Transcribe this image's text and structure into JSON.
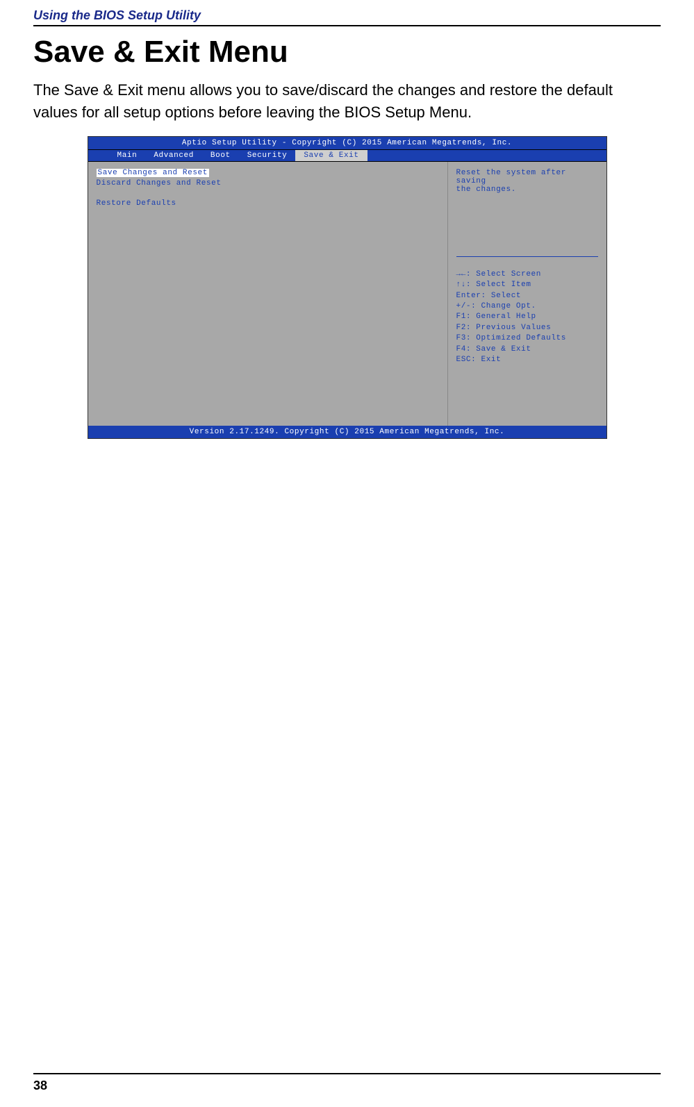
{
  "chapter": "Using the BIOS Setup Utility",
  "heading": "Save & Exit Menu",
  "body": "The Save & Exit menu allows you to save/discard the changes and restore the default values for all setup options before leaving the BIOS Setup Menu.",
  "bios": {
    "header": "Aptio Setup Utility - Copyright (C) 2015 American Megatrends, Inc.",
    "tabs": {
      "main": "Main",
      "advanced": "Advanced",
      "boot": "Boot",
      "security": "Security",
      "save_exit": "Save & Exit"
    },
    "menu": {
      "save_reset": "Save Changes and Reset",
      "discard_reset": "Discard Changes and Reset",
      "restore_defaults": "Restore Defaults"
    },
    "help": {
      "line1": "Reset the system after saving",
      "line2": "the changes."
    },
    "keys": {
      "k0": "→←: Select Screen",
      "k1": "↑↓: Select Item",
      "k2": "Enter: Select",
      "k3": "+/-: Change Opt.",
      "k4": "F1: General Help",
      "k5": "F2: Previous Values",
      "k6": "F3: Optimized Defaults",
      "k7": "F4: Save & Exit",
      "k8": "ESC: Exit"
    },
    "footer": "Version 2.17.1249. Copyright (C) 2015 American Megatrends, Inc."
  },
  "page_number": "38"
}
